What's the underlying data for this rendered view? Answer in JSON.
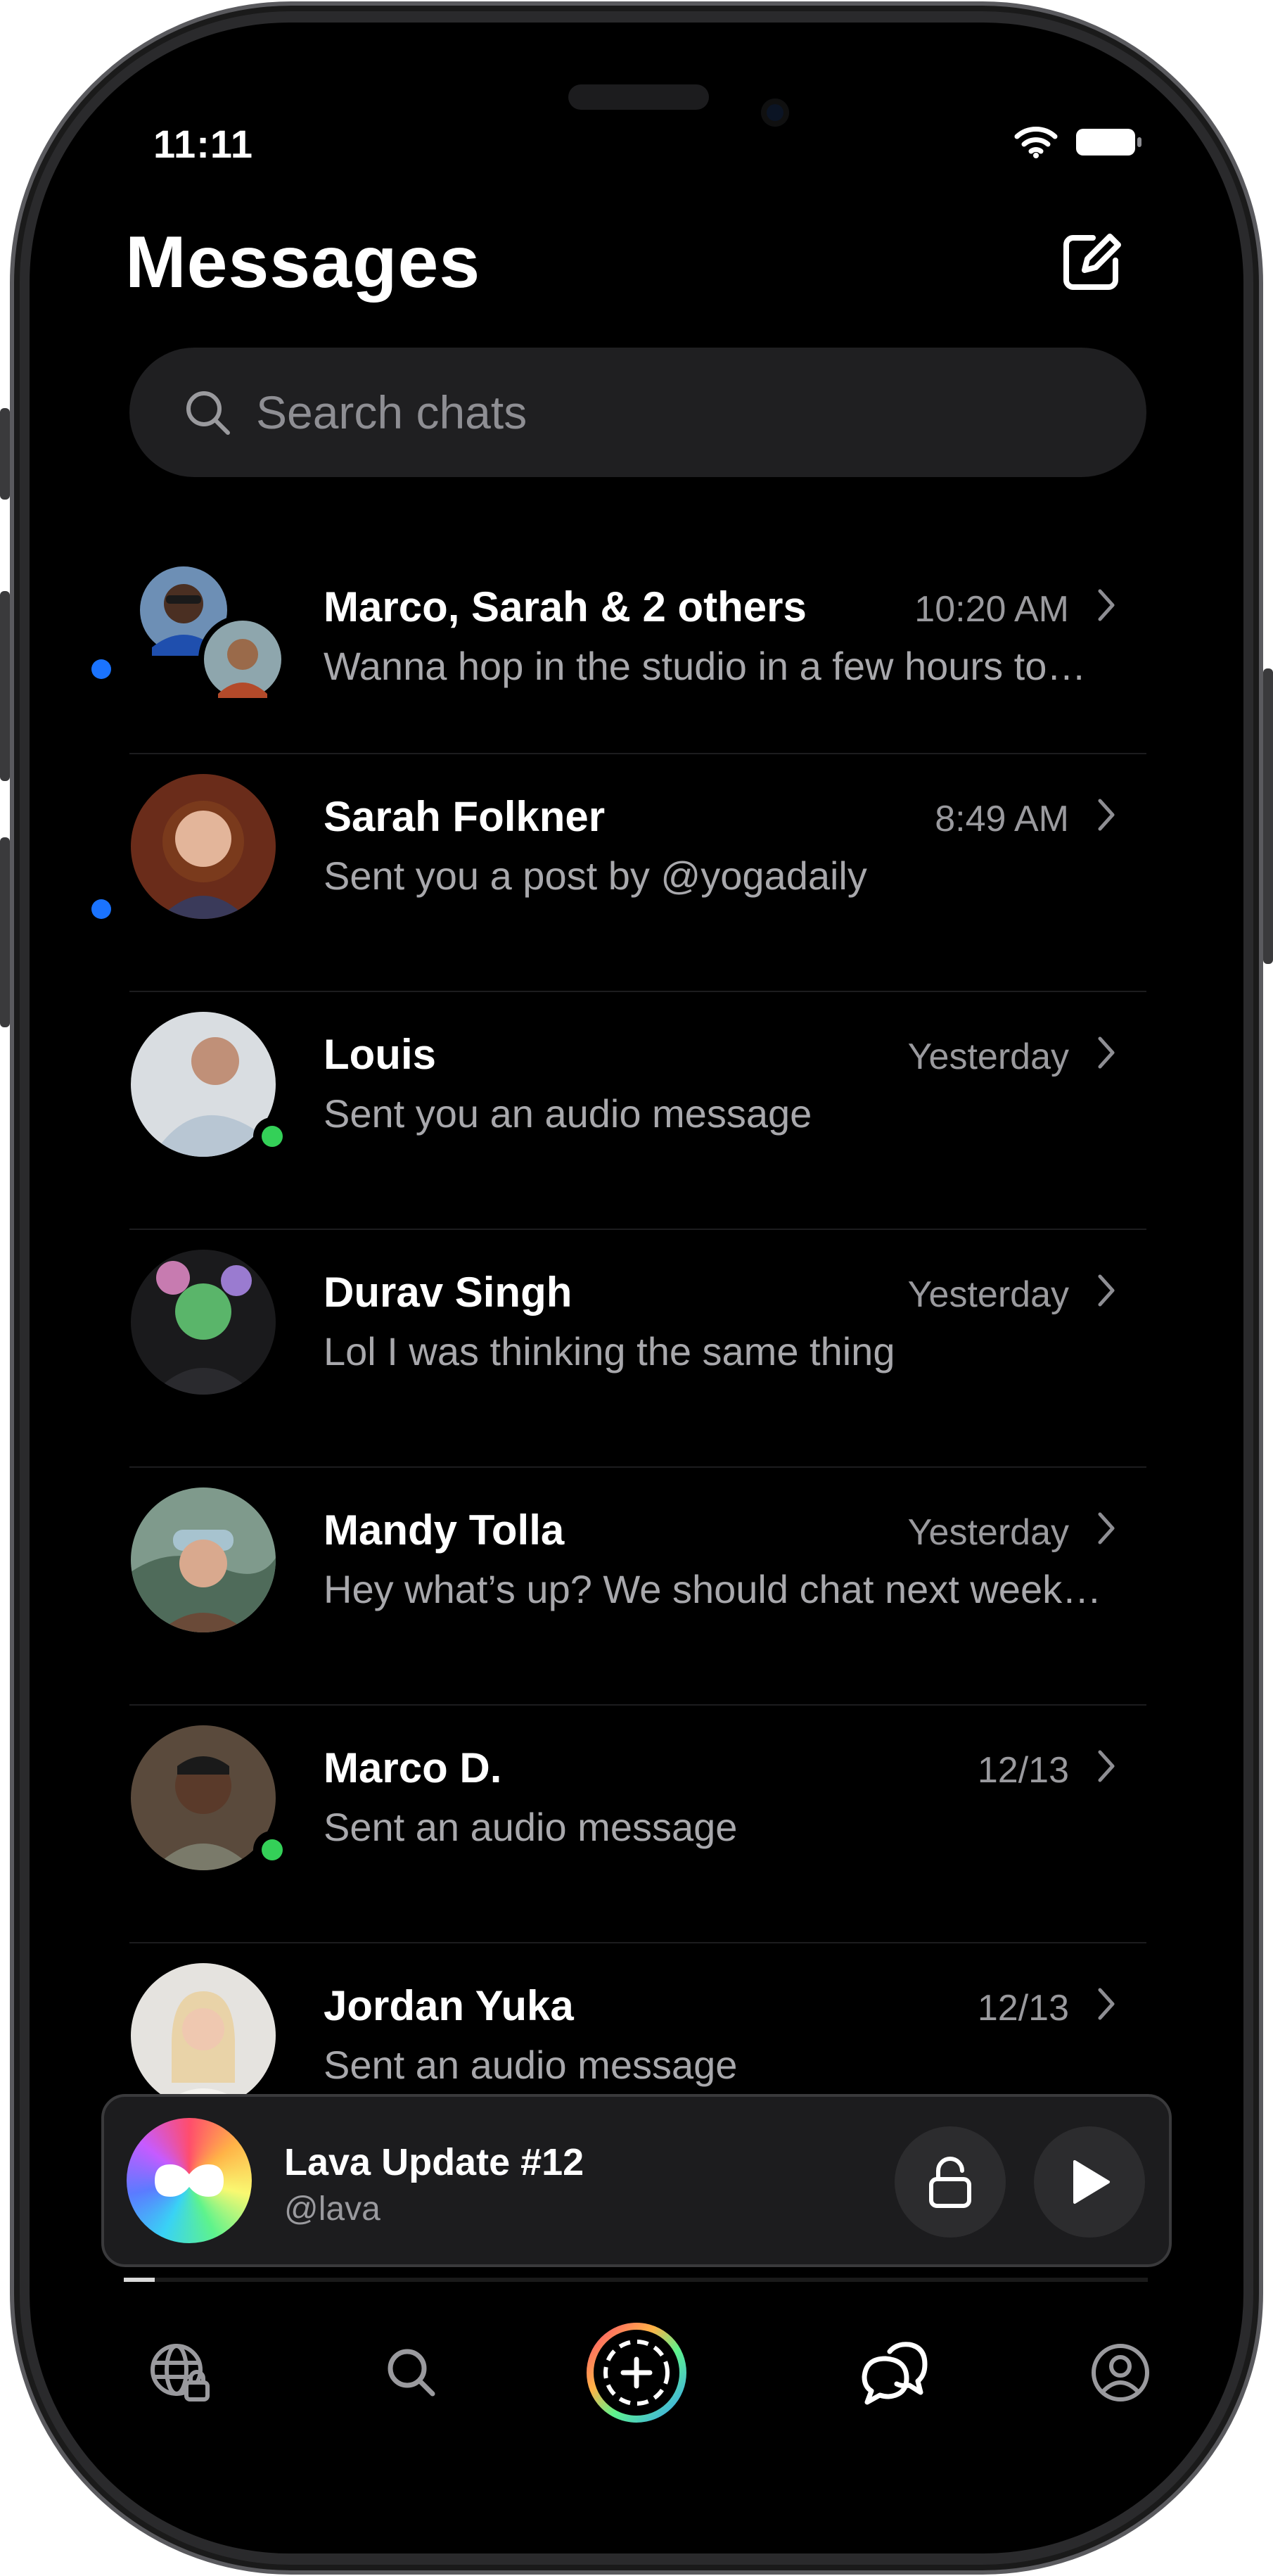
{
  "status_bar": {
    "time": "11:11"
  },
  "header": {
    "title": "Messages"
  },
  "search": {
    "placeholder": "Search chats"
  },
  "chats": [
    {
      "name": "Marco, Sarah & 2 others",
      "time": "10:20 AM",
      "preview": "Wanna hop in the studio in a few hours to…",
      "unread": true,
      "online": false,
      "group": true
    },
    {
      "name": "Sarah Folkner",
      "time": "8:49 AM",
      "preview": "Sent you a post by @yogadaily",
      "unread": true,
      "online": false
    },
    {
      "name": "Louis",
      "time": "Yesterday",
      "preview": "Sent you an audio message",
      "unread": false,
      "online": true
    },
    {
      "name": "Durav Singh",
      "time": "Yesterday",
      "preview": "Lol I was thinking the same thing",
      "unread": false,
      "online": false
    },
    {
      "name": "Mandy Tolla",
      "time": "Yesterday",
      "preview": "Hey what’s up? We should chat next week…",
      "unread": false,
      "online": false
    },
    {
      "name": "Marco D.",
      "time": "12/13",
      "preview": "Sent an audio message",
      "unread": false,
      "online": true
    },
    {
      "name": "Jordan Yuka",
      "time": "12/13",
      "preview": "Sent an audio message",
      "unread": false,
      "online": false
    }
  ],
  "player": {
    "title": "Lava Update #12",
    "handle": "@lava",
    "progress": 0.03
  },
  "tabbar": {
    "items": [
      "globe-icon",
      "search-icon",
      "add-circle-icon",
      "chat-bubbles-icon",
      "profile-icon"
    ],
    "active": "chat-bubbles-icon"
  },
  "colors": {
    "background": "#000000",
    "unread": "#1a73ff",
    "online": "#34d058",
    "secondary_text": "#9a9a9e"
  }
}
